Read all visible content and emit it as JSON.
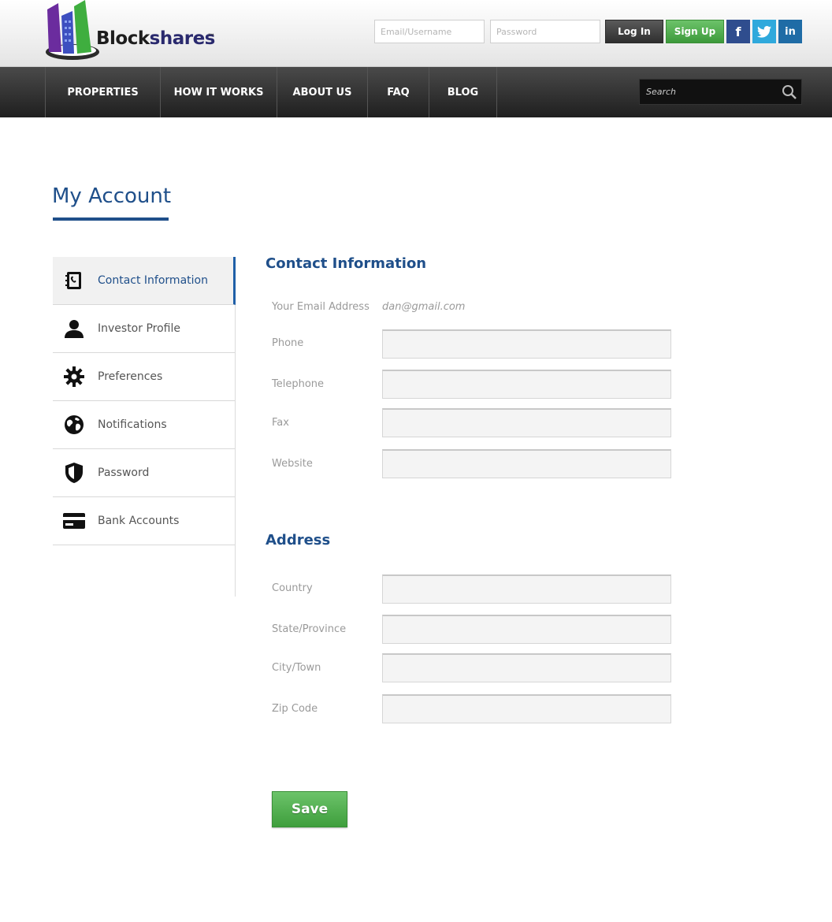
{
  "brand": {
    "name_part1": "Block",
    "name_part2": "shares",
    "trademark": "™"
  },
  "header": {
    "email_placeholder": "Email/Username",
    "password_placeholder": "Password",
    "login_label": "Log In",
    "signup_label": "Sign Up",
    "social": {
      "facebook": "f",
      "twitter": "t",
      "linkedin": "in"
    }
  },
  "nav": {
    "items": [
      {
        "label": "PROPERTIES"
      },
      {
        "label": "HOW IT WORKS"
      },
      {
        "label": "ABOUT US"
      },
      {
        "label": "FAQ"
      },
      {
        "label": "BLOG"
      }
    ],
    "search_placeholder": "Search"
  },
  "page": {
    "title": "My Account"
  },
  "sidebar": {
    "items": [
      {
        "label": "Contact Information",
        "icon": "contact-book-icon",
        "active": true
      },
      {
        "label": "Investor Profile",
        "icon": "person-icon",
        "active": false
      },
      {
        "label": "Preferences",
        "icon": "gear-icon",
        "active": false
      },
      {
        "label": "Notifications",
        "icon": "globe-icon",
        "active": false
      },
      {
        "label": "Password",
        "icon": "shield-icon",
        "active": false
      },
      {
        "label": "Bank Accounts",
        "icon": "credit-card-icon",
        "active": false
      }
    ]
  },
  "contact": {
    "title": "Contact Information",
    "email_label": "Your Email Address",
    "email_value": "dan@gmail.com",
    "fields": [
      {
        "label": "Phone",
        "value": ""
      },
      {
        "label": "Telephone",
        "value": ""
      },
      {
        "label": "Fax",
        "value": ""
      },
      {
        "label": "Website",
        "value": ""
      }
    ]
  },
  "address": {
    "title": "Address",
    "fields": [
      {
        "label": "Country",
        "value": ""
      },
      {
        "label": "State/Province",
        "value": ""
      },
      {
        "label": "City/Town",
        "value": ""
      },
      {
        "label": "Zip Code",
        "value": ""
      }
    ]
  },
  "save_label": "Save",
  "colors": {
    "primary": "#1f4f8a",
    "accent_green": "#4caf4a",
    "nav_dark": "#2a2a2a"
  }
}
